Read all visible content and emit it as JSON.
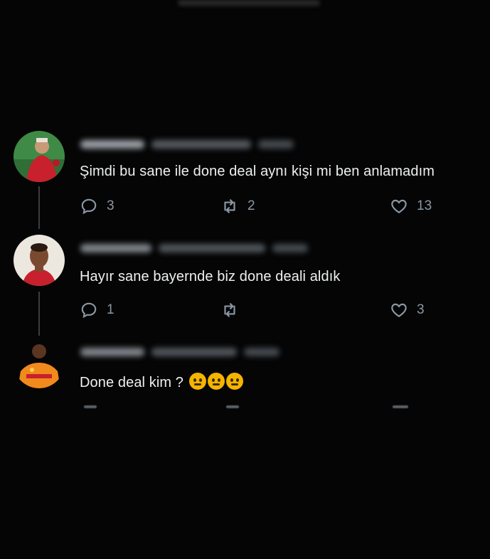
{
  "tweets": [
    {
      "text": "Şimdi bu sane ile done deal aynı kişi mi ben anlamadım",
      "replies": "3",
      "retweets": "2",
      "likes": "13"
    },
    {
      "text": "Hayır sane bayernde biz done deali aldık",
      "replies": "1",
      "retweets": "",
      "likes": "3"
    },
    {
      "text": "Done deal kim ?",
      "emoji_count": 3
    }
  ],
  "icons": {
    "reply": "reply-icon",
    "retweet": "retweet-icon",
    "like": "heart-icon",
    "emoji": "thinking-face-icon"
  },
  "colors": {
    "background": "#050505",
    "text": "#eef0f1",
    "muted": "#8b98a5",
    "thread_line": "#3a3d40"
  }
}
